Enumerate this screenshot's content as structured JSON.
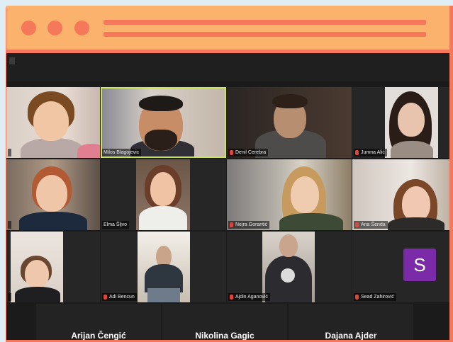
{
  "window": {
    "accent": "#f5785a",
    "titlebar_color": "#fbb26d"
  },
  "gallery": {
    "active_speaker": "Milos Blagojevic",
    "participants": [
      {
        "name": "",
        "video": true
      },
      {
        "name": "Milos Blagojevic",
        "video": true,
        "speaking": true
      },
      {
        "name": "Denil Cerebra",
        "video": true,
        "muted": true
      },
      {
        "name": "Jumna Alić",
        "video": true,
        "muted": true
      },
      {
        "name": "",
        "video": true
      },
      {
        "name": "Elma Šljvo",
        "video": true
      },
      {
        "name": "Nejra Gorantić",
        "video": true,
        "muted": true
      },
      {
        "name": "Ana Šenda",
        "video": true,
        "muted": true
      },
      {
        "name": "",
        "video": true
      },
      {
        "name": "Adi Bencun",
        "video": true,
        "muted": true
      },
      {
        "name": "Ajdin Aganović",
        "video": true,
        "muted": true
      },
      {
        "name": "Sead Zahirović",
        "video": false,
        "muted": true,
        "avatar_letter": "S",
        "avatar_color": "#7b2aa8"
      }
    ],
    "bottom_row": [
      "Arijan Čengić",
      "Nikolina Gagic",
      "Dajana Ajder"
    ]
  }
}
